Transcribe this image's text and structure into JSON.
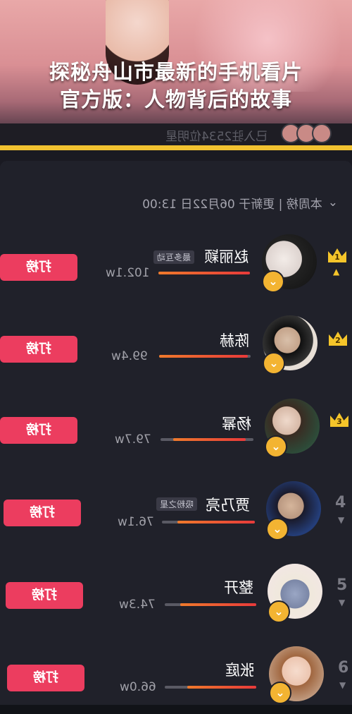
{
  "title": {
    "line1": "探秘舟山市最新的手机看片",
    "line2": "官方版：人物背后的故事"
  },
  "banner_faded_text": "已入驻2534位明星",
  "header": {
    "text": "本周榜 | 更新于 06月22日 13:00"
  },
  "rows": [
    {
      "rank": "1",
      "name": "赵丽颖",
      "tag": "最多互动",
      "score": "102.1w",
      "button": "打榜",
      "progress": 1.0,
      "trend": "up"
    },
    {
      "rank": "2",
      "name": "陈赫",
      "tag": "",
      "score": "99.4w",
      "button": "打榜",
      "progress": 0.97,
      "trend": ""
    },
    {
      "rank": "3",
      "name": "杨幂",
      "tag": "",
      "score": "79.7w",
      "button": "打榜",
      "progress": 0.78,
      "trend": ""
    },
    {
      "rank": "4",
      "name": "贾乃亮",
      "tag": "吸粉之星",
      "score": "76.1w",
      "button": "打榜",
      "progress": 0.75,
      "trend": "down"
    },
    {
      "rank": "5",
      "name": "整开",
      "tag": "",
      "score": "74.3w",
      "button": "打榜",
      "progress": 0.73,
      "trend": "down"
    },
    {
      "rank": "6",
      "name": "张庭",
      "tag": "",
      "score": "66.0w",
      "button": "打榜",
      "progress": 0.65,
      "trend": "down"
    }
  ],
  "colors": {
    "accent_button": "#ec3d5f",
    "highlight_line": "#f2c230",
    "crown": "#f5c52a",
    "progress_fill": "#e83a3a"
  },
  "icons": {
    "expand": "chevron-down-icon",
    "verified": "chevron-down-badge-icon",
    "crown": "crown-icon"
  }
}
